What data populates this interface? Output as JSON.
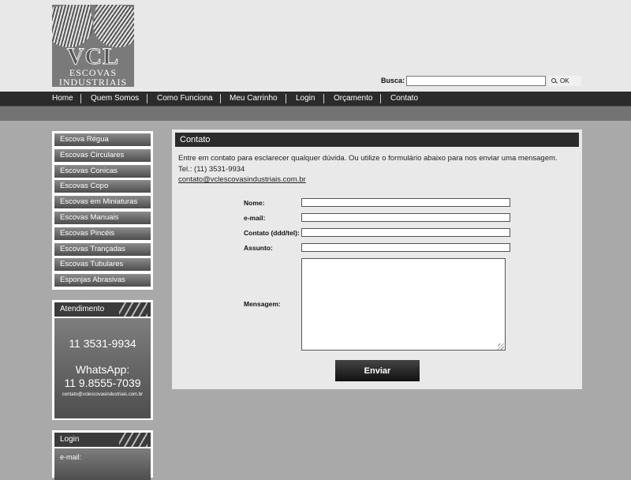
{
  "header": {
    "logo": {
      "word": "VCL",
      "line1": "ESCOVAS",
      "line2": "INDUSTRIAIS"
    },
    "search": {
      "label": "Busca:",
      "value": "",
      "button": "OK"
    }
  },
  "nav": {
    "items": [
      "Home",
      "Quem Somos",
      "Como Funciona",
      "Meu Carrinho",
      "Login",
      "Orçamento",
      "Contato"
    ]
  },
  "sidebar": {
    "categories": [
      "Escova Régua",
      "Escovas Circulares",
      "Escovas Conicas",
      "Escovas Copo",
      "Escovas em Miniaturas",
      "Escovas Manuais",
      "Escovas Pincéis",
      "Escovas Trançadas",
      "Escovas Tubulares",
      "Esponjas Abrasivas"
    ],
    "atendimento": {
      "title": "Atendimento",
      "phone": "11 3531-9934",
      "whatsapp_label": "WhatsApp:",
      "whatsapp": "11 9.8555-7039",
      "email": "contato@vclescovasindustriais.com.br"
    },
    "login": {
      "title": "Login",
      "email_label": "e-mail:"
    }
  },
  "content": {
    "title": "Contato",
    "intro": "Entre em contato para esclarecer qualquer dúvida. Ou utilize o formulário abaixo para nos enviar uma mensagem.",
    "tel": "Tel.: (11) 3531-9934",
    "email": "contato@vclescovasindustriais.com.br",
    "form": {
      "nome_label": "Nome:",
      "email_label": "e-mail:",
      "contato_label": "Contato (ddd/tel):",
      "assunto_label": "Assunto:",
      "mensagem_label": "Mensagem:",
      "submit": "Enviar"
    }
  },
  "colors": {
    "nav_bg": "#2b2b2b",
    "page_bg": "#a9a9a9",
    "header_bg": "#e8e8e8"
  }
}
